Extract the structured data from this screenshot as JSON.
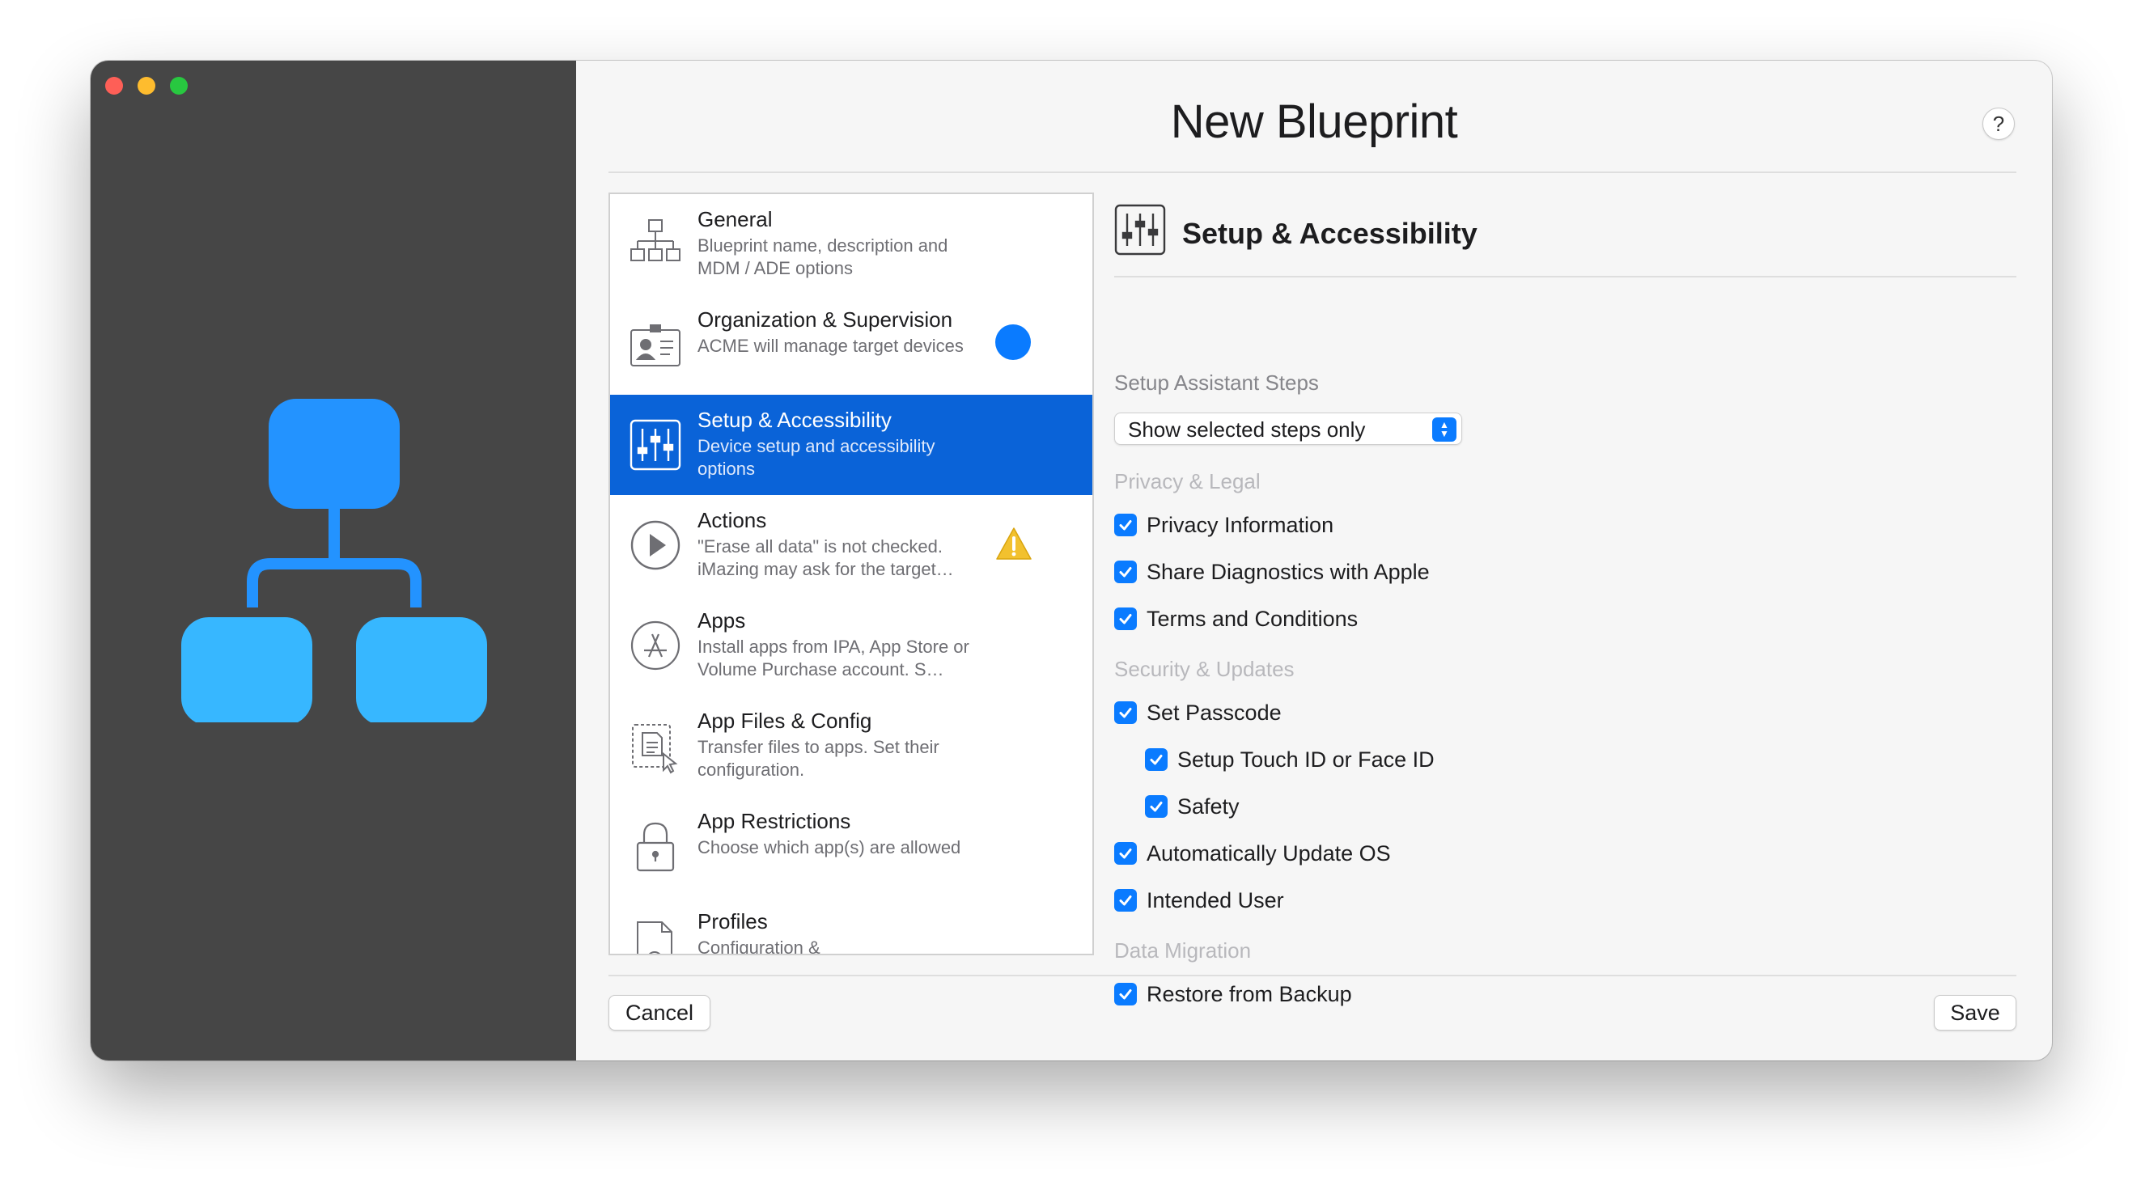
{
  "window": {
    "title": "New Blueprint",
    "help_label": "?"
  },
  "sidebar_items": [
    {
      "title": "General",
      "subtitle": "Blueprint name, description and MDM / ADE options",
      "icon": "hierarchy-icon"
    },
    {
      "title": "Organization & Supervision",
      "subtitle": "ACME will manage target devices",
      "icon": "id-card-icon",
      "badge": "blue-dot"
    },
    {
      "title": "Setup & Accessibility",
      "subtitle": "Device setup and accessibility options",
      "icon": "sliders-icon",
      "selected": true
    },
    {
      "title": "Actions",
      "subtitle": "\"Erase all data\" is not checked. iMazing may ask for the target…",
      "icon": "play-icon",
      "badge": "warning-icon"
    },
    {
      "title": "Apps",
      "subtitle": "Install apps from IPA, App Store or Volume Purchase account. S…",
      "icon": "app-store-icon"
    },
    {
      "title": "App Files & Config",
      "subtitle": "Transfer files to apps. Set their configuration.",
      "icon": "file-config-icon"
    },
    {
      "title": "App Restrictions",
      "subtitle": "Choose which app(s) are allowed",
      "icon": "lock-icon"
    },
    {
      "title": "Profiles",
      "subtitle": "Configuration &",
      "icon": "profile-gear-icon"
    }
  ],
  "section": {
    "title": "Setup & Accessibility",
    "steps_label": "Setup Assistant Steps",
    "steps_select": "Show selected steps only",
    "groups": {
      "privacy": "Privacy & Legal",
      "security": "Security & Updates",
      "migration": "Data Migration"
    },
    "checkboxes": {
      "privacy_info": "Privacy Information",
      "diagnostics": "Share Diagnostics with Apple",
      "terms": "Terms and Conditions",
      "passcode": "Set Passcode",
      "touch_id": "Setup Touch ID or Face ID",
      "safety": "Safety",
      "auto_update": "Automatically Update OS",
      "intended_user": "Intended User",
      "restore_backup": "Restore from Backup"
    }
  },
  "footer": {
    "cancel": "Cancel",
    "save": "Save"
  },
  "colors": {
    "accent": "#0a7bff",
    "selection": "#0a63d8",
    "sidebar": "#464646",
    "hero_top": "#2393ff",
    "hero_bottom": "#37b7ff"
  }
}
